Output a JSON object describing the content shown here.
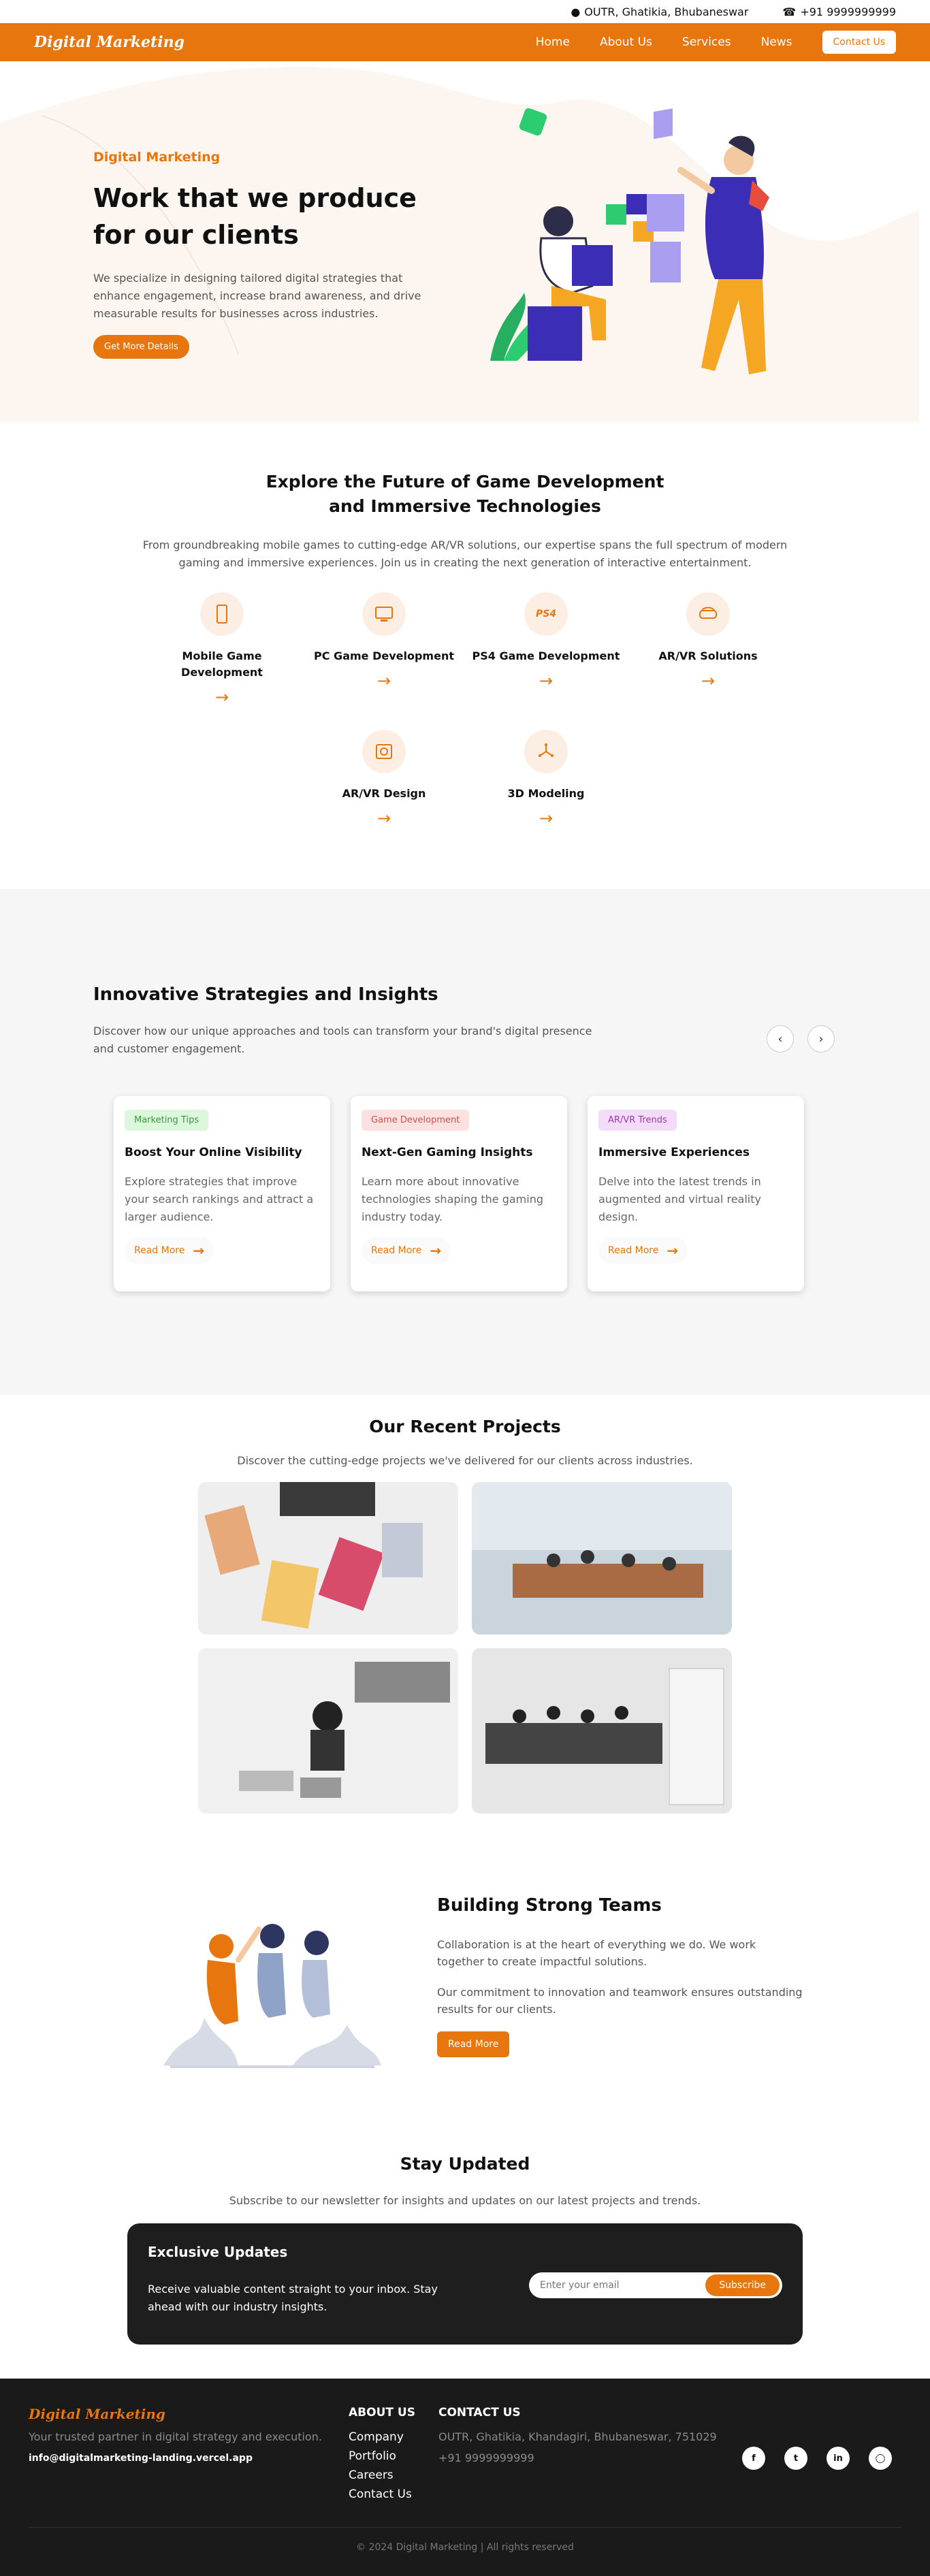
{
  "topbar": {
    "address": "OUTR, Ghatikia, Bhubaneswar",
    "phone": "+91 9999999999"
  },
  "nav": {
    "brand": "Digital Marketing",
    "links": [
      "Home",
      "About Us",
      "Services",
      "News"
    ],
    "contact": "Contact Us"
  },
  "hero": {
    "eyebrow": "Digital Marketing",
    "title": "Work that we produce for our clients",
    "desc": "We specialize in designing tailored digital strategies that enhance engagement, increase brand awareness, and drive measurable results for businesses across industries.",
    "cta": "Get More Details"
  },
  "services": {
    "title": "Explore the Future of Game Development and Immersive Technologies",
    "desc": "From groundbreaking mobile games to cutting-edge AR/VR solutions, our expertise spans the full spectrum of modern gaming and immersive experiences. Join us in creating the next generation of interactive entertainment.",
    "items": [
      {
        "label": "Mobile Game Development",
        "icon": "mobile-icon"
      },
      {
        "label": "PC Game Development",
        "icon": "pc-icon"
      },
      {
        "label": "PS4 Game Development",
        "icon": "ps4-icon"
      },
      {
        "label": "AR/VR Solutions",
        "icon": "vr-headset-icon"
      },
      {
        "label": "AR/VR Design",
        "icon": "design-icon"
      },
      {
        "label": "3D Modeling",
        "icon": "cube-icon"
      }
    ]
  },
  "insights": {
    "title": "Innovative Strategies and Insights",
    "desc": "Discover how our unique approaches and tools can transform your brand's digital presence and customer engagement.",
    "cards": [
      {
        "tag": "Marketing Tips",
        "tag_bg": "#dcf7dc",
        "tag_color": "#3a9a3a",
        "title": "Boost Your Online Visibility",
        "text": "Explore strategies that improve your search rankings and attract a larger audience.",
        "link": "Read More"
      },
      {
        "tag": "Game Development",
        "tag_bg": "#fde0e0",
        "tag_color": "#d05050",
        "title": "Next-Gen Gaming Insights",
        "text": "Learn more about innovative technologies shaping the gaming industry today.",
        "link": "Read More"
      },
      {
        "tag": "AR/VR Trends",
        "tag_bg": "#f3dcf7",
        "tag_color": "#9a3aaa",
        "title": "Immersive Experiences",
        "text": "Delve into the latest trends in augmented and virtual reality design.",
        "link": "Read More"
      }
    ]
  },
  "projects": {
    "title": "Our Recent Projects",
    "desc": "Discover the cutting-edge projects we've delivered for our clients across industries."
  },
  "teams": {
    "title": "Building Strong Teams",
    "p1": "Collaboration is at the heart of everything we do. We work together to create impactful solutions.",
    "p2": "Our commitment to innovation and teamwork ensures outstanding results for our clients.",
    "cta": "Read More"
  },
  "stay": {
    "title": "Stay Updated",
    "desc": "Subscribe to our newsletter for insights and updates on our latest projects and trends.",
    "box_title": "Exclusive Updates",
    "box_text": "Receive valuable content straight to your inbox. Stay ahead with our industry insights.",
    "placeholder": "Enter your email",
    "button": "Subscribe"
  },
  "footer": {
    "brand": "Digital Marketing",
    "tagline": "Your trusted partner in digital strategy and execution.",
    "email": "info@digitalmarketing-landing.vercel.app",
    "about_title": "ABOUT US",
    "about_links": [
      "Company",
      "Portfolio",
      "Careers",
      "Contact Us"
    ],
    "contact_title": "CONTACT US",
    "address": "OUTR, Ghatikia, Khandagiri, Bhubaneswar, 751029",
    "phone": "+91 9999999999",
    "copyright": "© 2024 Digital Marketing | All rights reserved"
  },
  "colors": {
    "accent": "#e8760f",
    "dark": "#1e1e1e"
  }
}
